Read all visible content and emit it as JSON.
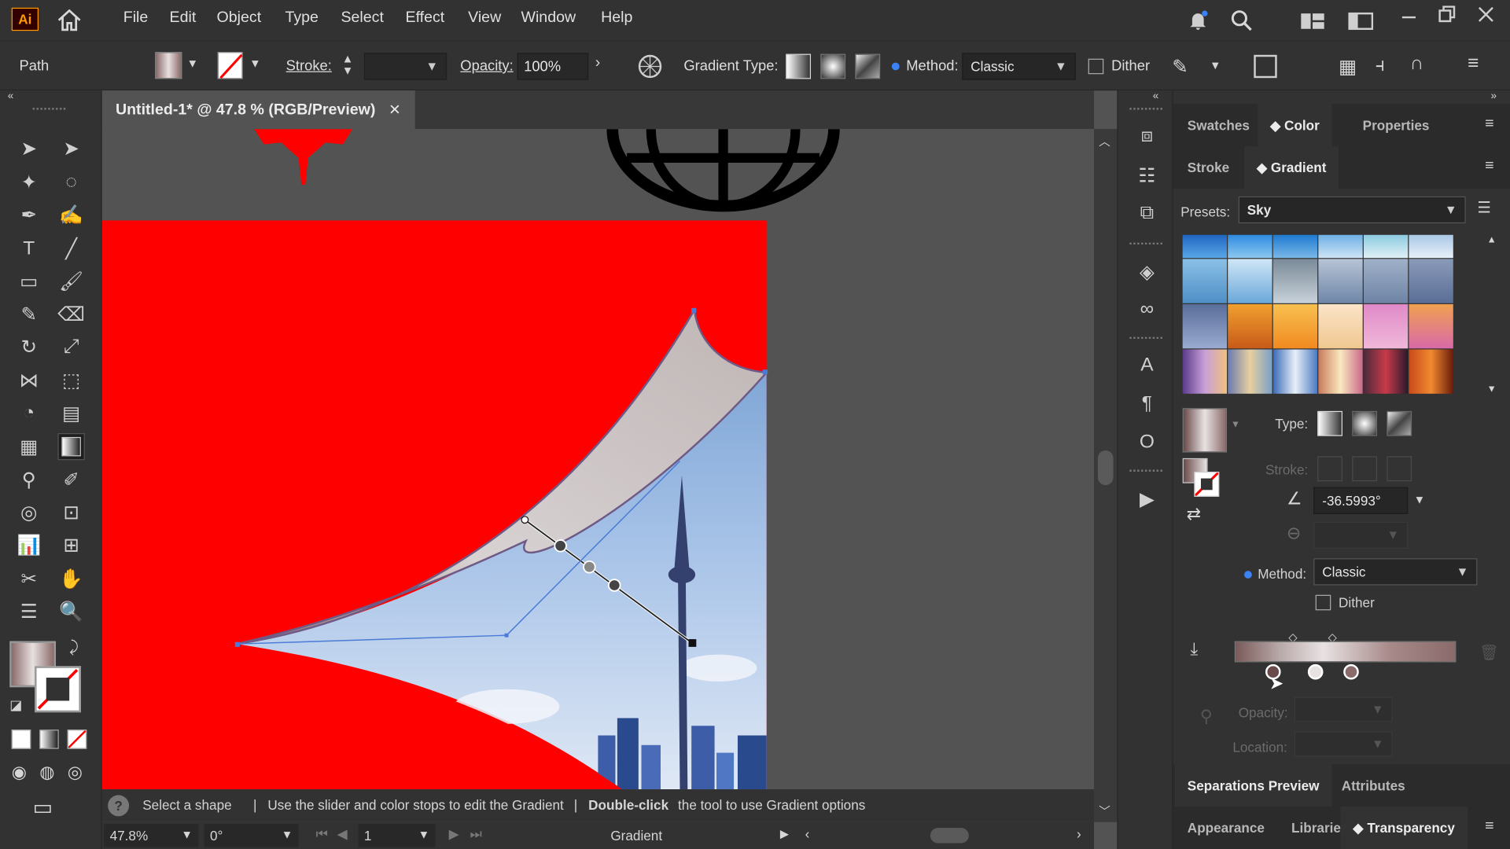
{
  "app": {
    "logo": "Ai"
  },
  "menu": [
    "File",
    "Edit",
    "Object",
    "Type",
    "Select",
    "Effect",
    "View",
    "Window",
    "Help"
  ],
  "control": {
    "selection_label": "Path",
    "stroke_label": "Stroke:",
    "opacity_label": "Opacity:",
    "opacity_value": "100%",
    "gradient_type_label": "Gradient Type:",
    "method_label": "Method:",
    "method_value": "Classic",
    "dither_label": "Dither"
  },
  "document": {
    "tab_title": "Untitled-1* @ 47.8 % (RGB/Preview)",
    "close": "×"
  },
  "status": {
    "help_icon": "?",
    "message_part1": "Select a shape",
    "message_sep1": "|",
    "message_part2": "Use the slider and color stops to edit the Gradient",
    "message_sep2": "|",
    "message_bold": "Double-click",
    "message_part3": "the tool to use Gradient options"
  },
  "bottom": {
    "zoom": "47.8%",
    "rotation": "0°",
    "artboard": "1",
    "tool_name": "Gradient"
  },
  "panel_top_tabs": [
    "Swatches",
    "Color",
    "Properties"
  ],
  "panel_sub_tabs": [
    "Stroke",
    "Gradient"
  ],
  "gradient_panel": {
    "presets_label": "Presets:",
    "presets_value": "Sky",
    "type_label": "Type:",
    "stroke_label": "Stroke:",
    "angle_value": "-36.5993°",
    "method_label": "Method:",
    "method_value": "Classic",
    "dither_label": "Dither",
    "opacity_label": "Opacity:",
    "location_label": "Location:"
  },
  "bottom_tabs_1": [
    "Separations Preview",
    "Attributes"
  ],
  "bottom_tabs_2": [
    "Appearance",
    "Libraries",
    "Transparency"
  ],
  "colors": {
    "accent_red": "#ff0000",
    "ui_dark": "#323232",
    "canvas_bg": "#535353",
    "highlight_blue": "#3b82f6"
  },
  "icons": [
    "home-icon",
    "bell-icon",
    "search-icon",
    "workspace-icon",
    "minimize-icon",
    "restore-icon",
    "close-icon",
    "gradient-tool-icon",
    "eyedropper-icon",
    "hand-icon",
    "zoom-icon"
  ]
}
